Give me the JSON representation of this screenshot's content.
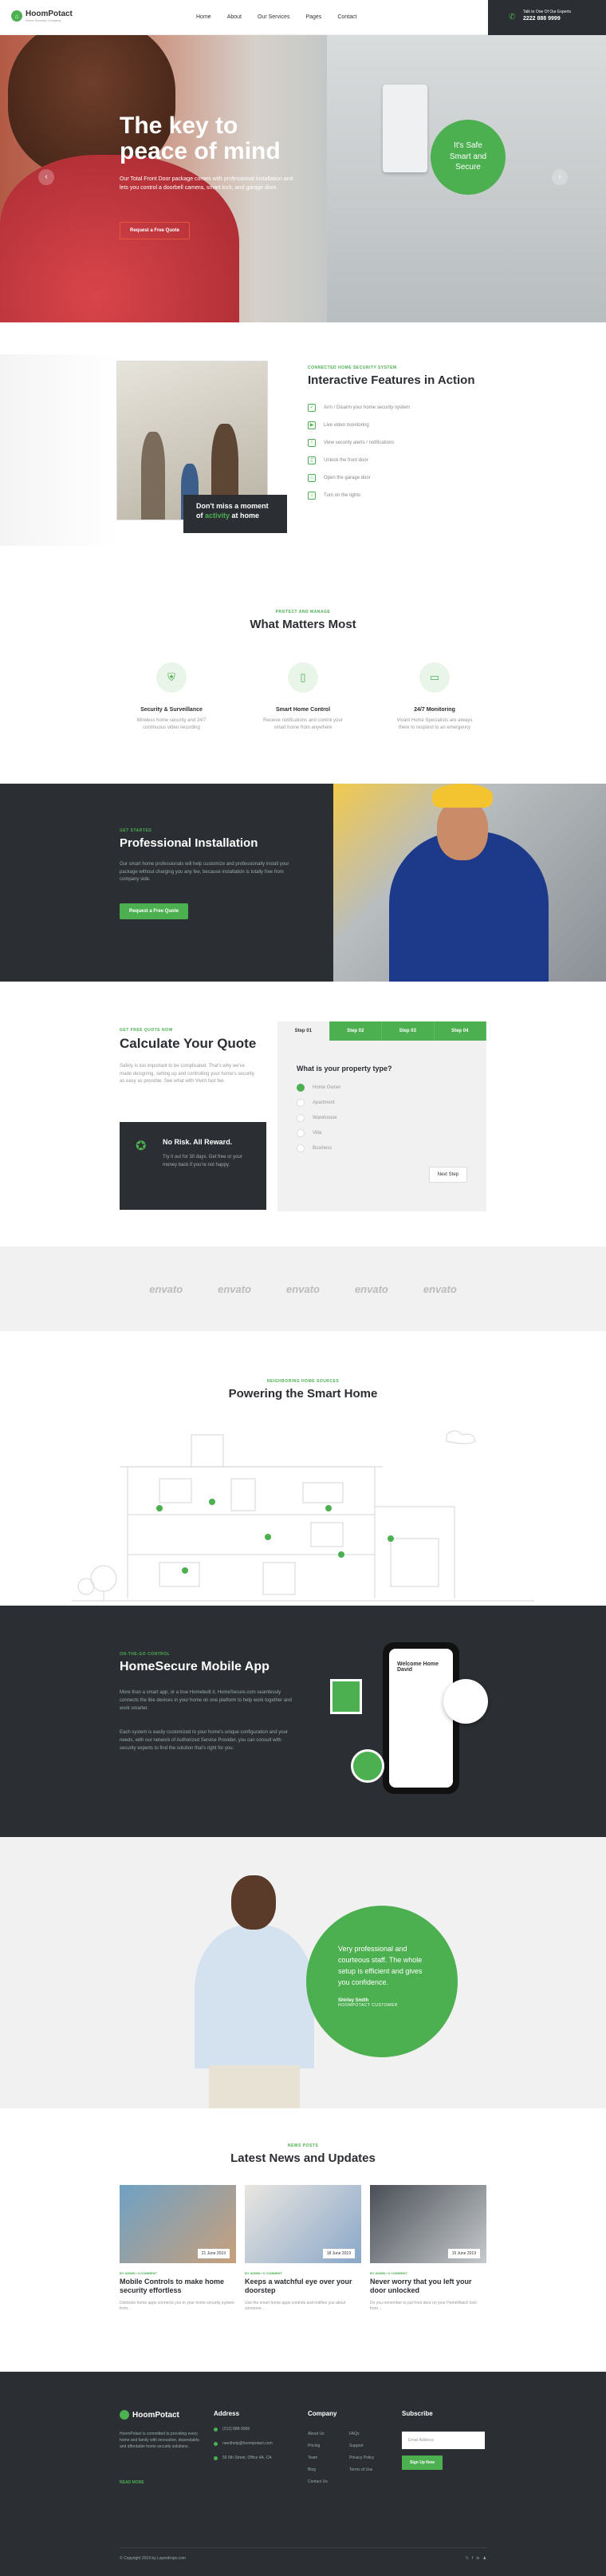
{
  "brand": {
    "name": "HoomPotact",
    "tagline": "Home Security Company"
  },
  "nav": [
    "Home",
    "About",
    "Our Services",
    "Pages",
    "Contact"
  ],
  "callbox": {
    "label": "Talk to One Of Our Experts",
    "phone": "2222 888 9999"
  },
  "hero": {
    "title_line1": "The key to",
    "title_line2": "peace of mind",
    "subtitle": "Our Total Front Door package comes with professional installation and lets you control a doorbell camera, smart lock, and garage door.",
    "cta": "Request a Free Quote",
    "badge_line1": "It's Safe",
    "badge_line2": "Smart and",
    "badge_line3": "Secure"
  },
  "features": {
    "kicker": "CONNECTED HOME SECURITY SYSTEM",
    "title": "Interactive Features in Action",
    "callout_line1": "Don't miss a moment",
    "callout_line2a": "of ",
    "callout_line2b": "activity",
    "callout_line2c": " at home",
    "items": [
      "Arm / Disarm your home security system",
      "Live video monitoring",
      "View security alerts / notifications",
      "Unlock the front door",
      "Open the garage door",
      "Turn on the lights"
    ]
  },
  "matters": {
    "kicker": "PROTECT AND MANAGE",
    "title": "What Matters Most",
    "cols": [
      {
        "title": "Security & Surveillance",
        "text": "Wireless home security and 24/7 continuous video recording"
      },
      {
        "title": "Smart Home Control",
        "text": "Receive notifications and control your smart home from anywhere"
      },
      {
        "title": "24/7 Monitoring",
        "text": "Vivant Home Specialists are always there to respond to an emergency"
      }
    ]
  },
  "install": {
    "kicker": "GET STARTED",
    "title": "Professional Installation",
    "text": "Our smart home professionals will help customize and professionally install your package without charging you any fee, because installation is totally free from company side.",
    "cta": "Request a Free Quote"
  },
  "quote": {
    "kicker": "GET FREE QUOTE NOW",
    "title": "Calculate Your Quote",
    "text": "Safety is too important to be complicated. That's why we've made designing, setting up and controlling your home's security as easy as possible. See what with Vivint fast fee.",
    "risk_title": "No Risk. All Reward.",
    "risk_text": "Try it out for 30 days. Get free or your money back if you're not happy.",
    "tabs": [
      "Step 01",
      "Step 02",
      "Step 03",
      "Step 04"
    ],
    "question": "What is your property type?",
    "options": [
      "Home Owner",
      "Apartment",
      "Warehouse",
      "Villa",
      "Business"
    ],
    "next": "Next Step"
  },
  "logos": [
    "envato",
    "envato",
    "envato",
    "envato",
    "envato"
  ],
  "powering": {
    "kicker": "NEIGHBORING HOME SOURCES",
    "title": "Powering the Smart Home"
  },
  "app": {
    "kicker": "ON-THE-GO CONTROL",
    "title": "HomeSecure Mobile App",
    "p1": "More than a smart app, or a true Homebuilt it, HomeSecure.com seamlessly connects the like devices in your home on one platform to help work together and work smarter.",
    "p2": "Each system is easily customized to your home's unique configuration and your needs, with our network of Authorized Service Provider, you can consult with security experts to find the solution that's right for you.",
    "screen_title_line1": "Welcome Home",
    "screen_title_line2": "David"
  },
  "testimonial": {
    "quote": "Very professional and courteous staff. The whole setup is efficient and gives you confidence.",
    "name": "Shirley Smith",
    "role": "HOOMPOTACT CUSTOMER"
  },
  "news": {
    "kicker": "NEWS POSTS",
    "title": "Latest News and Updates",
    "items": [
      {
        "meta": "BY ADMIN  /  0 COMMENT",
        "date": "21 June 2019",
        "title": "Mobile Controls to make home security effortless",
        "text": "Distinctio home apps connects you to your home security system from…"
      },
      {
        "meta": "BY ADMIN  /  0 COMMENT",
        "date": "18 June 2019",
        "title": "Keeps a watchful eye over your doorstep",
        "text": "Use the smart home apps controls and notifies you about someone…"
      },
      {
        "meta": "BY ADMIN  /  0 COMMENT",
        "date": "15 June 2019",
        "title": "Never worry that you left your door unlocked",
        "text": "Do you remember to put front door on your HomeWatch lock from…"
      }
    ]
  },
  "footer": {
    "about": "HoomPotact is committed to providing every home and family with innovative, dependable, and affordable home security solutions.",
    "more": "READ MORE",
    "address_title": "Address",
    "address": [
      "(212) 888-9999",
      "needhelp@hoompotact.com",
      "55 6th Street, Office 4A, CA"
    ],
    "company_title": "Company",
    "links": [
      "About Us",
      "FAQs",
      "Pricing",
      "Support",
      "Team",
      "Privacy Policy",
      "Blog",
      "Terms of Use",
      "Contact Us"
    ],
    "subscribe_title": "Subscribe",
    "email_placeholder": "Email Address",
    "subscribe_btn": "Sign Up Now",
    "copyright": "© Copyright 2019 by Layerdrops.com",
    "social": [
      "𝕏",
      "f",
      "in",
      "♟"
    ]
  },
  "colors": {
    "accent": "#4caf50",
    "dark": "#2b2e33"
  }
}
